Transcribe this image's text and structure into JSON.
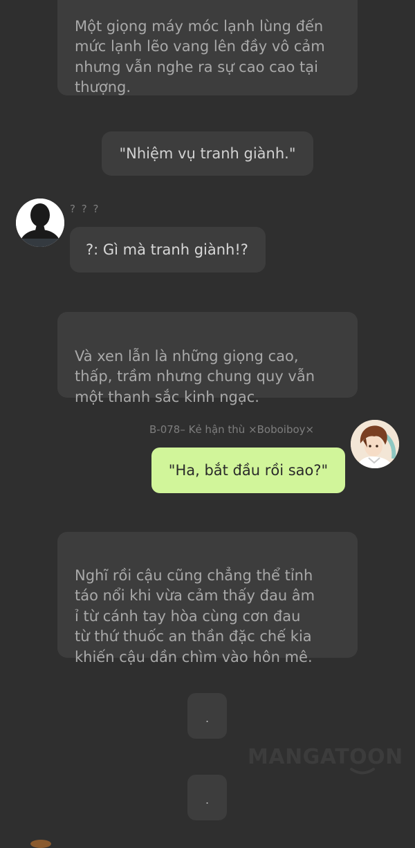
{
  "messages": {
    "narration_1": "Một giọng máy móc lạnh lùng đến\nmức lạnh lẽo vang lên đầy vô cảm\nnhưng vẫn nghe ra sự cao cao tại\nthượng.",
    "quote_1": "\"Nhiệm vụ tranh giành.\"",
    "unknown_sender_name": "? ? ?",
    "unknown_message": "?: Gì mà tranh giành!?",
    "narration_2": "Và xen lẫn là những giọng cao,\nthấp, trầm nhưng chung quy vẫn\nmột thanh sắc kinh ngạc.",
    "player_sender_name": "B-078– Kẻ hận thù  ×Boboiboy×",
    "player_message": "\"Ha, bắt đầu rồi sao?\"",
    "narration_3": "Nghĩ rồi cậu cũng chẳng thể tỉnh\ntáo nổi khi vừa cảm thấy đau âm\nỉ từ cánh tay hòa cùng cơn đau\ntừ thứ thuốc an thần đặc chế kia\nkhiến cậu dần chìm vào hôn mê.",
    "dot_1": ".",
    "dot_2": "."
  },
  "watermark": "MANGATOON",
  "colors": {
    "background": "#2f2f2f",
    "bubble": "#3d3d3d",
    "player_bubble": "#d1f59a",
    "narration_text": "#a9a9a9",
    "dialogue_text": "#d2d2d2"
  },
  "icons": {
    "unknown_avatar": "silhouette-avatar-icon",
    "player_avatar": "anime-boy-avatar-icon"
  }
}
